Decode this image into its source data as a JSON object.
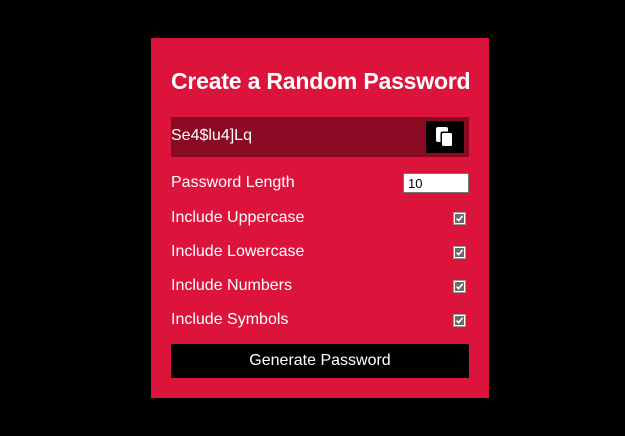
{
  "card": {
    "title": "Create a Random Password"
  },
  "result": {
    "password": "Se4$lu4]Lq",
    "copy_icon": "clipboard-icon"
  },
  "settings": {
    "length": {
      "label": "Password Length",
      "value": "10"
    },
    "uppercase": {
      "label": "Include Uppercase",
      "checked": true
    },
    "lowercase": {
      "label": "Include Lowercase",
      "checked": true
    },
    "numbers": {
      "label": "Include Numbers",
      "checked": true
    },
    "symbols": {
      "label": "Include Symbols",
      "checked": true
    }
  },
  "generate_button": {
    "label": "Generate Password"
  },
  "colors": {
    "background": "#000000",
    "card": "#dc143c",
    "result_box": "#8a0a24",
    "button": "#000000",
    "text": "#ffffff"
  }
}
